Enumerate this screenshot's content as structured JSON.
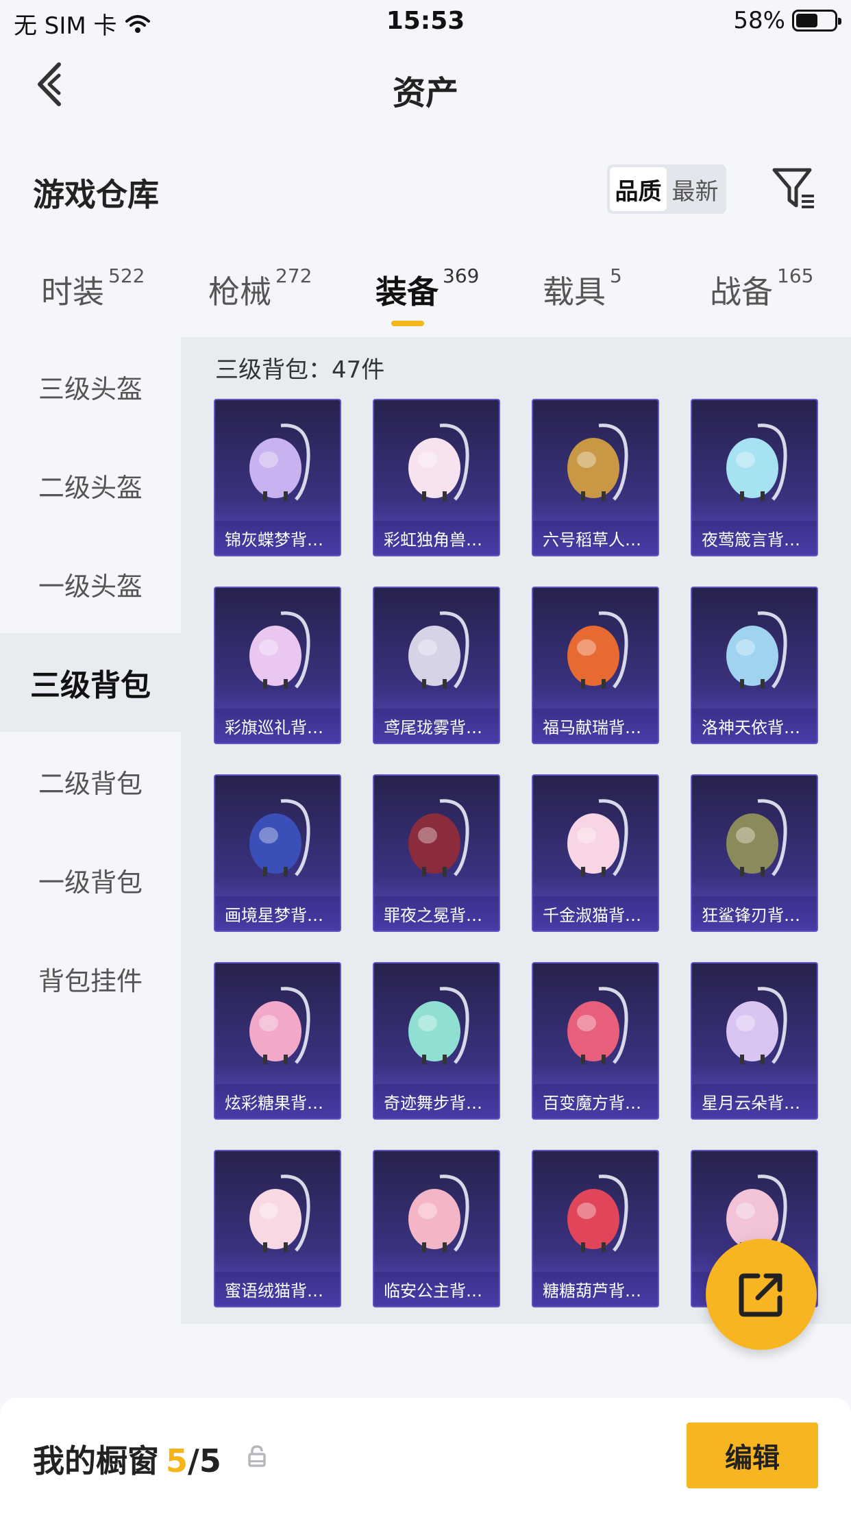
{
  "status_bar": {
    "carrier": "无 SIM 卡",
    "time": "15:53",
    "battery_pct": "58%",
    "battery_level": 0.58
  },
  "nav": {
    "title": "资产"
  },
  "header": {
    "section_title": "游戏仓库",
    "sort_options": [
      "品质",
      "最新"
    ],
    "sort_active": "品质"
  },
  "categories": [
    {
      "label": "时装",
      "count": "522"
    },
    {
      "label": "枪械",
      "count": "272"
    },
    {
      "label": "装备",
      "count": "369",
      "active": true
    },
    {
      "label": "载具",
      "count": "5"
    },
    {
      "label": "战备",
      "count": "165"
    }
  ],
  "sidebar": {
    "items": [
      "三级头盔",
      "二级头盔",
      "一级头盔",
      "三级背包",
      "二级背包",
      "一级背包",
      "背包挂件"
    ],
    "active": "三级背包"
  },
  "content": {
    "summary": "三级背包：47件",
    "items": [
      {
        "name": "锦灰蝶梦背…",
        "art": "butterfly-frame-backpack",
        "color": "#c8b3f0"
      },
      {
        "name": "彩虹独角兽…",
        "art": "unicorn-backpack",
        "color": "#f6e3ef"
      },
      {
        "name": "六号稻草人…",
        "art": "scarecrow-backpack",
        "color": "#c99845"
      },
      {
        "name": "夜莺箴言背…",
        "art": "jellyfish-backpack",
        "color": "#a7e2f2"
      },
      {
        "name": "彩旗巡礼背…",
        "art": "bow-backpack",
        "color": "#e9c7f0"
      },
      {
        "name": "鸢尾珑雾背…",
        "art": "crystal-backpack",
        "color": "#d6d3e6"
      },
      {
        "name": "福马献瑞背…",
        "art": "horse-backpack",
        "color": "#e86a33"
      },
      {
        "name": "洛神天依背…",
        "art": "star-backpack",
        "color": "#9fd3f0"
      },
      {
        "name": "画境星梦背…",
        "art": "mirror-frame-backpack",
        "color": "#3b4fb8"
      },
      {
        "name": "罪夜之冕背…",
        "art": "throne-backpack",
        "color": "#8a2c3b"
      },
      {
        "name": "千金淑猫背…",
        "art": "cat-lace-backpack",
        "color": "#f7d5e4"
      },
      {
        "name": "狂鲨锋刃背…",
        "art": "shark-backpack",
        "color": "#8c8a5a"
      },
      {
        "name": "炫彩糖果背…",
        "art": "donut-backpack",
        "color": "#f2a9c9"
      },
      {
        "name": "奇迹舞步背…",
        "art": "wing-backpack",
        "color": "#8fe0d2"
      },
      {
        "name": "百变魔方背…",
        "art": "cube-backpack",
        "color": "#e85f7c"
      },
      {
        "name": "星月云朵背…",
        "art": "cloud-backpack",
        "color": "#d9c4f2"
      },
      {
        "name": "蜜语绒猫背…",
        "art": "plush-cat-backpack",
        "color": "#f8d9e3"
      },
      {
        "name": "临安公主背…",
        "art": "blossom-backpack",
        "color": "#f4b6c6"
      },
      {
        "name": "糖糖葫芦背…",
        "art": "lantern-backpack",
        "color": "#e0455a"
      },
      {
        "name": "",
        "art": "dress-backpack",
        "color": "#f2c3d6"
      }
    ]
  },
  "showcase": {
    "title": "我的橱窗",
    "count": "5",
    "total": "/5",
    "edit_label": "编辑"
  },
  "icons": {
    "back": "chevron-left-icon",
    "filter": "filter-icon",
    "share": "share-icon",
    "lock": "lock-icon",
    "wifi": "wifi-icon",
    "battery": "battery-icon"
  },
  "colors": {
    "accent": "#f7b621",
    "card_border": "#5f55c5"
  }
}
